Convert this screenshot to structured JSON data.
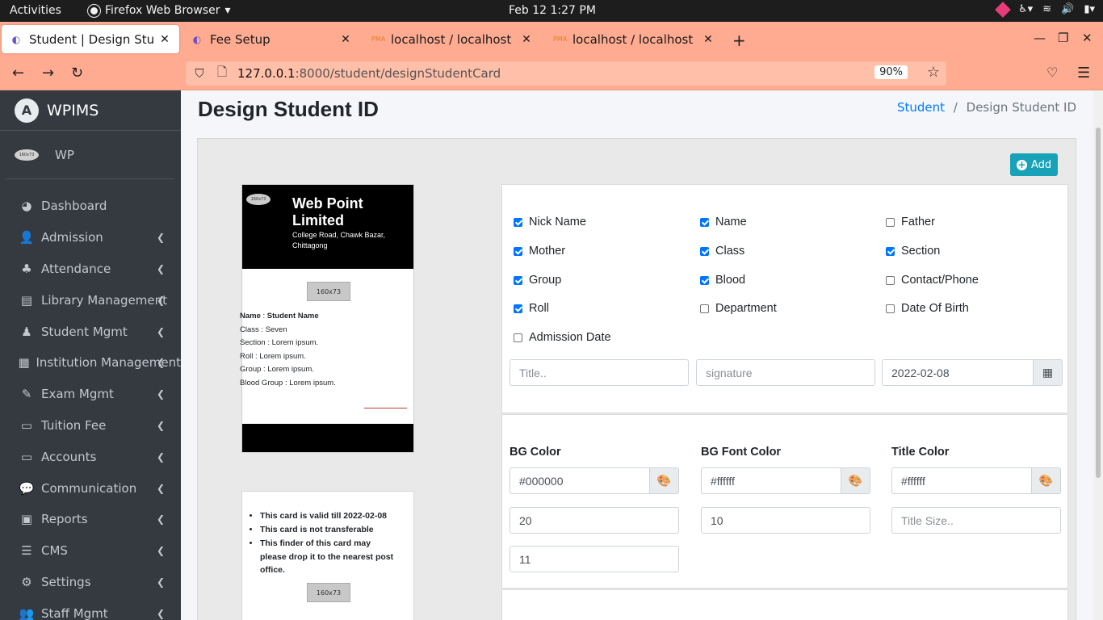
{
  "os": {
    "activities": "Activities",
    "app_name": "Firefox Web Browser",
    "clock": "Feb 12  1:27 PM"
  },
  "browser": {
    "tabs": [
      {
        "label": "Student | Design Student ID",
        "active": true
      },
      {
        "label": "Fee Setup",
        "active": false
      },
      {
        "label": "localhost / localhost / wp",
        "active": false
      },
      {
        "label": "localhost / localhost / wp",
        "active": false
      }
    ],
    "url_host": "127.0.0.1",
    "url_path": ":8000/student/designStudentCard",
    "zoom": "90%"
  },
  "sidebar": {
    "brand": "WPIMS",
    "user": "WP",
    "avatar_text": "160x73",
    "items": [
      {
        "label": "Dashboard",
        "icon": "tachometer-icon",
        "glyph": "◕",
        "expandable": false
      },
      {
        "label": "Admission",
        "icon": "user-plus-icon",
        "glyph": "👤",
        "expandable": true
      },
      {
        "label": "Attendance",
        "icon": "tree-icon",
        "glyph": "♣",
        "expandable": true
      },
      {
        "label": "Library Management",
        "icon": "book-icon",
        "glyph": "▤",
        "expandable": true
      },
      {
        "label": "Student Mgmt",
        "icon": "graduate-icon",
        "glyph": "♟",
        "expandable": true
      },
      {
        "label": "Institution Management",
        "icon": "table-icon",
        "glyph": "▦",
        "expandable": true
      },
      {
        "label": "Exam Mgmt",
        "icon": "reader-icon",
        "glyph": "✎",
        "expandable": true
      },
      {
        "label": "Tuition Fee",
        "icon": "id-card-icon",
        "glyph": "▭",
        "expandable": true
      },
      {
        "label": "Accounts",
        "icon": "id-card-icon",
        "glyph": "▭",
        "expandable": true
      },
      {
        "label": "Communication",
        "icon": "comments-icon",
        "glyph": "💬",
        "expandable": true
      },
      {
        "label": "Reports",
        "icon": "chalkboard-icon",
        "glyph": "▣",
        "expandable": true
      },
      {
        "label": "CMS",
        "icon": "list-icon",
        "glyph": "☰",
        "expandable": true
      },
      {
        "label": "Settings",
        "icon": "cogs-icon",
        "glyph": "⚙",
        "expandable": true
      },
      {
        "label": "Staff Mgmt",
        "icon": "users-icon",
        "glyph": "👥",
        "expandable": true
      }
    ]
  },
  "page": {
    "title": "Design Student ID",
    "breadcrumb_link": "Student",
    "breadcrumb_sep": "/",
    "breadcrumb_current": "Design Student ID",
    "add_button": "Add"
  },
  "id_card": {
    "logo_text": "160x73",
    "title": "Web Point Limited",
    "address": "College Road, Chawk Bazar, Chittagong",
    "photo_text": "160x73",
    "fields": [
      {
        "label": "Name",
        "value": "Student Name",
        "bold": true
      },
      {
        "label": "Class",
        "value": "Seven",
        "bold": false
      },
      {
        "label": "Section",
        "value": "Lorem ipsum.",
        "bold": false
      },
      {
        "label": "Roll",
        "value": "Lorem ipsum.",
        "bold": false
      },
      {
        "label": "Group",
        "value": "Lorem ipsum.",
        "bold": false
      },
      {
        "label": "Blood Group",
        "value": "Lorem ipsum.",
        "bold": false
      }
    ],
    "back_rules": [
      "This card is valid till 2022-02-08",
      "This card is not transferable",
      "This finder of this card may please drop it to the nearest post office."
    ],
    "back_photo_text": "160x73"
  },
  "options": {
    "checkboxes": [
      {
        "label": "Nick Name",
        "checked": true
      },
      {
        "label": "Name",
        "checked": true
      },
      {
        "label": "Father",
        "checked": false
      },
      {
        "label": "Mother",
        "checked": true
      },
      {
        "label": "Class",
        "checked": true
      },
      {
        "label": "Section",
        "checked": true
      },
      {
        "label": "Group",
        "checked": true
      },
      {
        "label": "Blood",
        "checked": true
      },
      {
        "label": "Contact/Phone",
        "checked": false
      },
      {
        "label": "Roll",
        "checked": true
      },
      {
        "label": "Department",
        "checked": false
      },
      {
        "label": "Date Of Birth",
        "checked": false
      },
      {
        "label": "Admission Date",
        "checked": false
      }
    ],
    "title_placeholder": "Title..",
    "signature_placeholder": "signature",
    "date_value": "2022-02-08"
  },
  "colors": {
    "bg_color_label": "BG Color",
    "bg_color_value": "#000000",
    "bg_font_color_label": "BG Font Color",
    "bg_font_color_value": "#ffffff",
    "title_color_label": "Title Color",
    "title_color_value": "#ffffff",
    "size_1": "20",
    "size_2": "10",
    "title_size_placeholder": "Title Size..",
    "size_3": "11"
  },
  "theme": {
    "sidebar_bg": "#343a40",
    "tabstrip_bg": "#ffab91",
    "accent": "#17a2b8",
    "link": "#007bff"
  }
}
